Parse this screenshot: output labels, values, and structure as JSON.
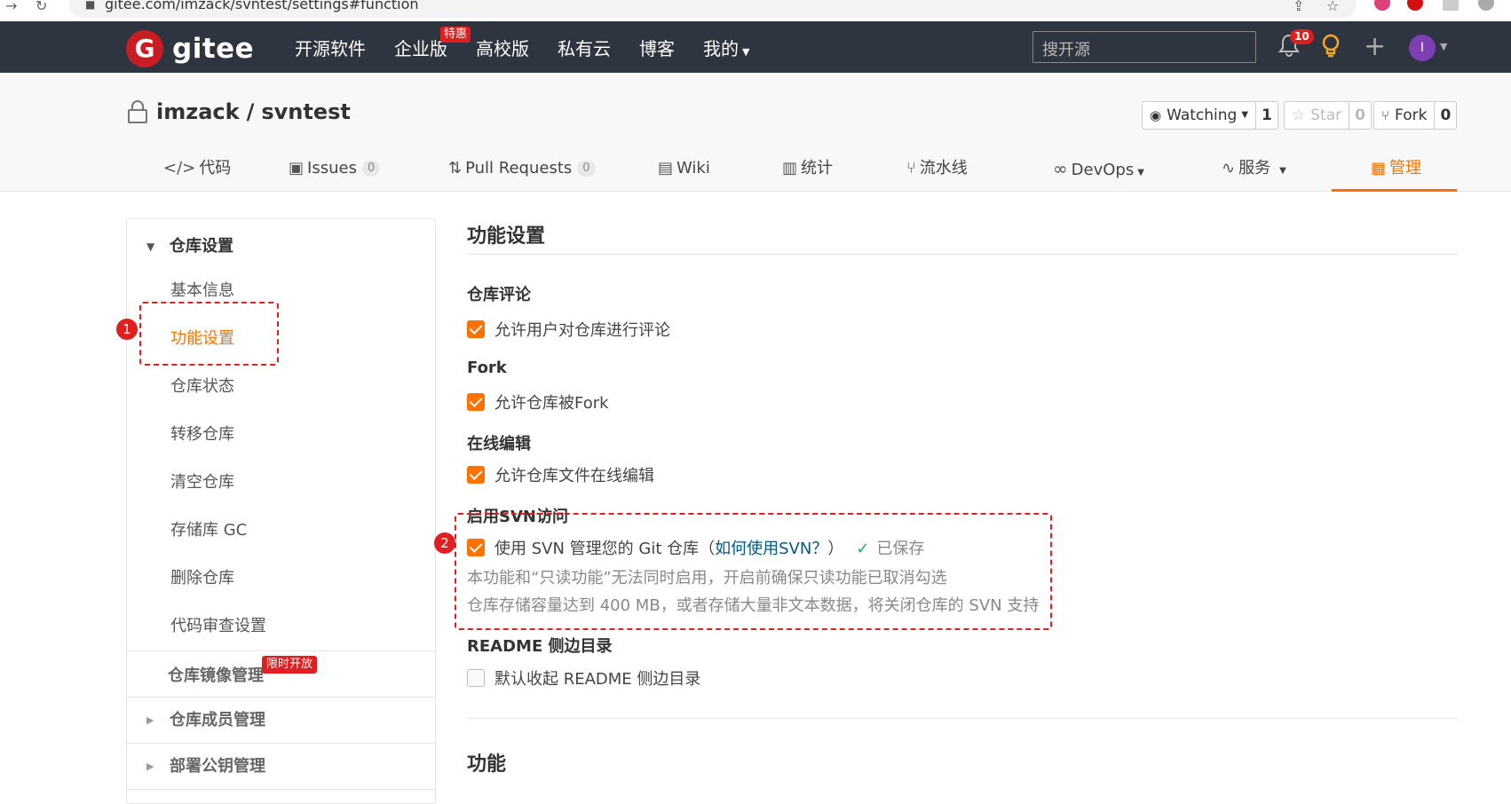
{
  "browser": {
    "url": "gitee.com/imzack/svntest/settings#function"
  },
  "header": {
    "logo_text": "gitee",
    "nav": [
      "开源软件",
      "企业版",
      "高校版",
      "私有云",
      "博客",
      "我的"
    ],
    "enterprise_badge": "特惠",
    "search_placeholder": "搜开源",
    "notification_count": "10",
    "avatar_letter": "I"
  },
  "repo": {
    "owner": "imzack",
    "separator": "/",
    "name": "svntest",
    "watch_label": "Watching",
    "watch_count": "1",
    "star_label": "Star",
    "star_count": "0",
    "fork_label": "Fork",
    "fork_count": "0"
  },
  "tabs": [
    {
      "label": "代码",
      "icon": "code-icon"
    },
    {
      "label": "Issues",
      "count": "0",
      "icon": "issues-icon"
    },
    {
      "label": "Pull Requests",
      "count": "0",
      "icon": "pull-request-icon"
    },
    {
      "label": "Wiki",
      "icon": "wiki-icon"
    },
    {
      "label": "统计",
      "icon": "stats-icon"
    },
    {
      "label": "流水线",
      "icon": "pipeline-icon"
    },
    {
      "label": "DevOps",
      "icon": "devops-icon"
    },
    {
      "label": "服务",
      "icon": "service-icon"
    },
    {
      "label": "管理",
      "icon": "manage-icon",
      "active": true
    }
  ],
  "sidebar": {
    "repo_settings_heading": "仓库设置",
    "items": [
      "基本信息",
      "功能设置",
      "仓库状态",
      "转移仓库",
      "清空仓库",
      "存储库 GC",
      "删除仓库",
      "代码审查设置"
    ],
    "active_item": "功能设置",
    "mirror_heading": "仓库镜像管理",
    "mirror_badge": "限时开放",
    "members_heading": "仓库成员管理",
    "keys_heading": "部署公钥管理"
  },
  "annotations": [
    "1",
    "2"
  ],
  "main": {
    "title": "功能设置",
    "sections": {
      "comment": {
        "label": "仓库评论",
        "option": "允许用户对仓库进行评论",
        "checked": true
      },
      "fork": {
        "label": "Fork",
        "option": "允许仓库被Fork",
        "checked": true
      },
      "online_edit": {
        "label": "在线编辑",
        "option": "允许仓库文件在线编辑",
        "checked": true
      },
      "svn": {
        "label": "启用SVN访问",
        "option": "使用 SVN 管理您的 Git 仓库（",
        "link": "如何使用SVN？",
        "option_close": "）",
        "saved": "已保存",
        "checked": true,
        "note1": "本功能和“只读功能”无法同时启用，开启前确保只读功能已取消勾选",
        "note2": "仓库存储容量达到 400 MB，或者存储大量非文本数据，将关闭仓库的 SVN 支持"
      },
      "readme": {
        "label": "README 侧边目录",
        "option": "默认收起 README 侧边目录",
        "checked": false
      }
    },
    "next_title": "功能"
  },
  "colors": {
    "accent": "#fe7300",
    "header_bg": "#2e3440",
    "brand_red": "#c71d23",
    "annotation_red": "#e02020"
  }
}
